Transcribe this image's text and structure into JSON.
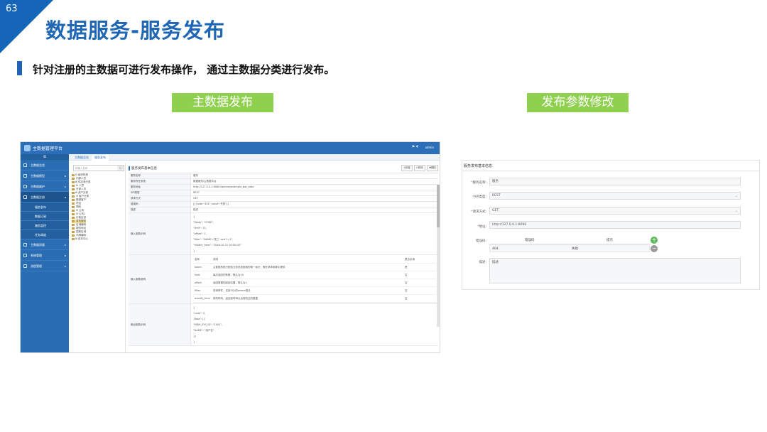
{
  "slide": {
    "page_number": "63",
    "title": "数据服务-服务发布",
    "subtitle": "针对注册的主数据可进行发布操作，  通过主数据分类进行发布。",
    "tag_left": "主数据发布",
    "tag_right": "发布参数修改"
  },
  "left_app": {
    "app_name": "主数据管理平台",
    "user": "admin",
    "bell": "⚑ 4",
    "menu_toggle": "☰",
    "sidebar": [
      {
        "label": "主数据总览"
      },
      {
        "label": "主数据模型"
      },
      {
        "label": "主数据维护"
      },
      {
        "label": "主数据注册"
      },
      {
        "label": "服务发布"
      },
      {
        "label": "数据订阅"
      },
      {
        "label": "服务监控"
      },
      {
        "label": "任务调度"
      },
      {
        "label": "主数据质量"
      },
      {
        "label": "系统管理"
      },
      {
        "label": "流程管理"
      }
    ],
    "tabs": {
      "t1": "主数据总览",
      "t2": "服务发布"
    },
    "tree_search_placeholder": "请输入名称",
    "tree_search_btn": "Q",
    "tree": [
      "⊟ 组织机构",
      "   内部人员",
      "⊞ 供应商分类",
      "   ⊟ 人员",
      "      外部人员",
      "⊞ 资产分类",
      "   ⊟ 客户分类",
      "      集团客户",
      "      项目",
      "      物料",
      "   ⊟ 公司",
      "      ⊟ 公司1",
      "         行政区划",
      "         发布服务",
      "         区域编码",
      "         服务地址",
      "         国家区域",
      "         币种编码",
      "⊞ 成本中心"
    ],
    "detail_title": "服务发布基本信息",
    "detail_buttons": [
      "+新增",
      "↺修改",
      "✖删除"
    ],
    "rows": [
      {
        "k": "服务名称",
        "v": "服务"
      },
      {
        "k": "服务所在系统",
        "v": "数据服务/主数据平台"
      },
      {
        "k": "服务地址",
        "v": "http://127.0.0.1:8080/api/rest/example_bot_data"
      },
      {
        "k": "API类型",
        "v": "REST"
      },
      {
        "k": "请求方式",
        "v": "GET"
      },
      {
        "k": "错误码",
        "v": "[{'code':'404','value':'失败'}]"
      },
      {
        "k": "描述",
        "v": "描述"
      }
    ],
    "input_example_label": "输入参数示例",
    "input_example": [
      "{",
      "  \"fields\": \"CODE\",",
      "  \"limit\": 10,",
      "  \"offset\": 1,",
      "  \"filter\": \"NAME='张三' and 1=1\",",
      "  \"modify_time\": \"2018-10-21 00:00:00\"",
      "}"
    ],
    "input_desc_label": "输入参数说明",
    "input_desc_head": [
      "名称",
      "说明",
      "是否必填"
    ],
    "input_desc_rows": [
      [
        "token",
        "主数据系统分配给业务系统使用的唯一标识，需在请求参数中提供",
        "是"
      ],
      [
        "limit",
        "每次返回的条数，默认为10",
        "否"
      ],
      [
        "offset",
        "返回数据的起始位置，默认为1",
        "否"
      ],
      [
        "filter",
        "查询条件，支持SQL的where语法",
        "否"
      ],
      [
        "modify_time",
        "修改时间，返回该时间以后修改过的数据",
        "否"
      ]
    ],
    "output_example_label": "输出参数示例",
    "output_example": [
      "{",
      "  \"code\": 0,",
      "  \"data\": [{",
      "    \"MDM_SYS_ID\": \"1001\",",
      "    \"NAME\": \"用户名\"",
      "  }]",
      "}"
    ]
  },
  "right_app": {
    "title": "服务发布基本信息",
    "service_name_label": "服务名称:",
    "service_name": "服务",
    "api_type_label": "API类型:",
    "api_type": "REST",
    "method_label": "请求方式:",
    "method": "GET",
    "address_label": "地址:",
    "address": "http://127.0.0.1:8090",
    "error_code_label": "错误码:",
    "error_head": [
      "错误码",
      "提示"
    ],
    "error_row": [
      "404",
      "失败"
    ],
    "plus": "+",
    "minus": "−",
    "desc_label": "描述:",
    "desc": "描述",
    "caret": "⌄"
  }
}
